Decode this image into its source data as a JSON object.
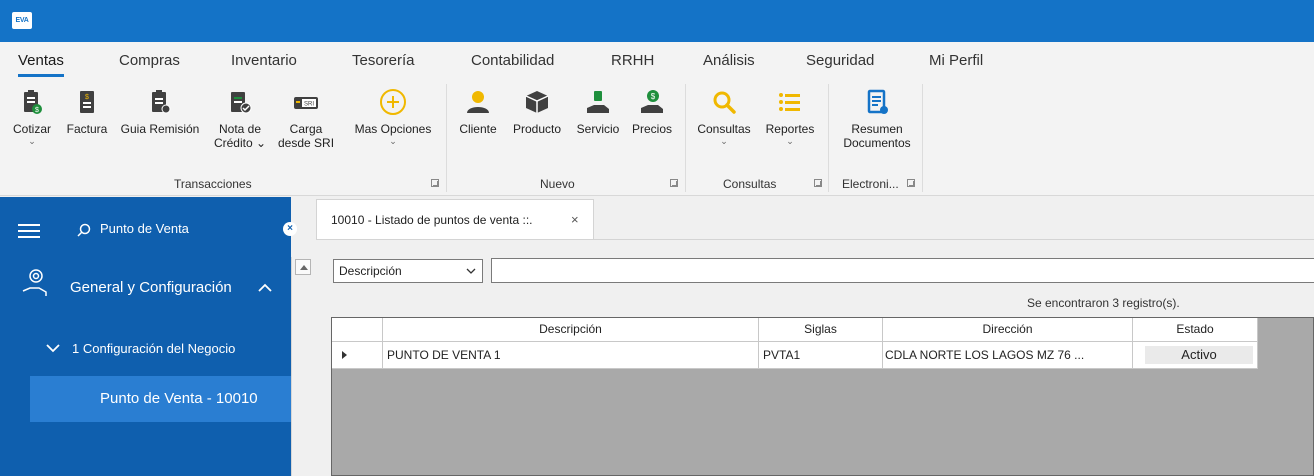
{
  "app": {
    "logo_text": "EVA"
  },
  "menu": {
    "tabs": [
      {
        "label": "Ventas"
      },
      {
        "label": "Compras"
      },
      {
        "label": "Inventario"
      },
      {
        "label": "Tesorería"
      },
      {
        "label": "Contabilidad"
      },
      {
        "label": "RRHH"
      },
      {
        "label": "Análisis"
      },
      {
        "label": "Seguridad"
      },
      {
        "label": "Mi Perfil"
      }
    ],
    "active_tab": "Ventas"
  },
  "ribbon": {
    "buttons": {
      "cotizar": {
        "line1": "Cotizar",
        "chevron": "⌄"
      },
      "factura": {
        "line1": "Factura"
      },
      "guia": {
        "line1": "Guia Remisión"
      },
      "nota": {
        "line1": "Nota de",
        "line2": "Crédito ⌄"
      },
      "carga": {
        "line1": "Carga",
        "line2": "desde SRI",
        "icon_text": "SRI"
      },
      "mas": {
        "line1": "Mas Opciones",
        "chevron": "⌄"
      },
      "cliente": {
        "line1": "Cliente"
      },
      "producto": {
        "line1": "Producto"
      },
      "servicio": {
        "line1": "Servicio"
      },
      "precios": {
        "line1": "Precios"
      },
      "consultas": {
        "line1": "Consultas",
        "chevron": "⌄"
      },
      "reportes": {
        "line1": "Reportes",
        "chevron": "⌄"
      },
      "resumen": {
        "line1": "Resumen",
        "line2": "Documentos"
      }
    },
    "groups": {
      "transacciones": "Transacciones",
      "nuevo": "Nuevo",
      "consultas": "Consultas",
      "electronica": "Electroni..."
    },
    "colors": {
      "dark": "#404040",
      "accent_green": "#1e8f3c",
      "accent_yellow": "#f0b800",
      "accent_blue": "#1473c7"
    }
  },
  "sidebar": {
    "search_text": "Punto de Venta",
    "clear_icon": "⊗",
    "section": "General y Configuración",
    "subsection": "1 Configuración del Negocio",
    "selected_item": "Punto de Venta - 10010"
  },
  "document_tab": {
    "title": "10010 - Listado de puntos de venta ::.",
    "close": "×"
  },
  "filter": {
    "field": "Descripción",
    "value": ""
  },
  "records": {
    "count_text": "Se encontraron 3 registro(s)."
  },
  "grid": {
    "columns": [
      "Descripción",
      "Siglas",
      "Dirección",
      "Estado"
    ],
    "rows": [
      {
        "descripcion": "PUNTO DE VENTA 1",
        "siglas": "PVTA1",
        "direccion": "CDLA NORTE LOS LAGOS MZ 76 ...",
        "estado": "Activo"
      }
    ]
  }
}
